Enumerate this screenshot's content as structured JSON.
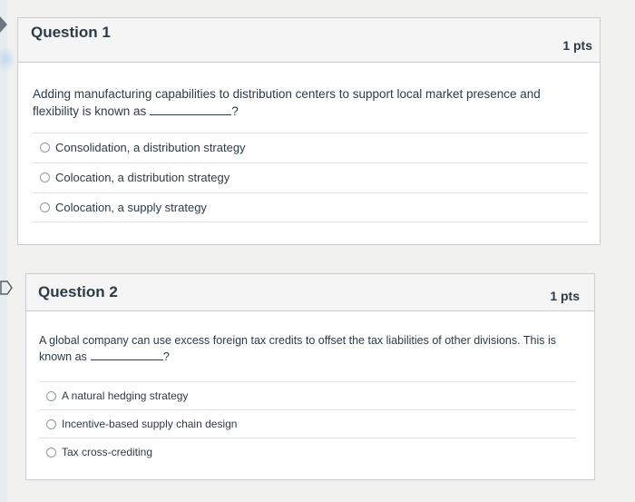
{
  "questions": [
    {
      "title": "Question 1",
      "points": "1 pts",
      "text_line1": "Adding manufacturing capabilities to distribution centers to support local market presence and",
      "text_line2": "flexibility is known as",
      "blank_suffix": "?",
      "answers": [
        {
          "label": "Consolidation, a distribution strategy",
          "selected": false
        },
        {
          "label": "Colocation, a distribution strategy",
          "selected": false
        },
        {
          "label": "Colocation, a supply strategy",
          "selected": false
        }
      ]
    },
    {
      "title": "Question 2",
      "points": "1 pts",
      "text_line1": "A global company can use excess foreign tax credits to offset the tax liabilities of other divisions. This is",
      "text_line2": "known as",
      "blank_suffix": "?",
      "answers": [
        {
          "label": "A natural hedging strategy",
          "selected": false
        },
        {
          "label": "Incentive-based supply chain design",
          "selected": false
        },
        {
          "label": "Tax cross-crediting",
          "selected": false
        }
      ]
    }
  ]
}
